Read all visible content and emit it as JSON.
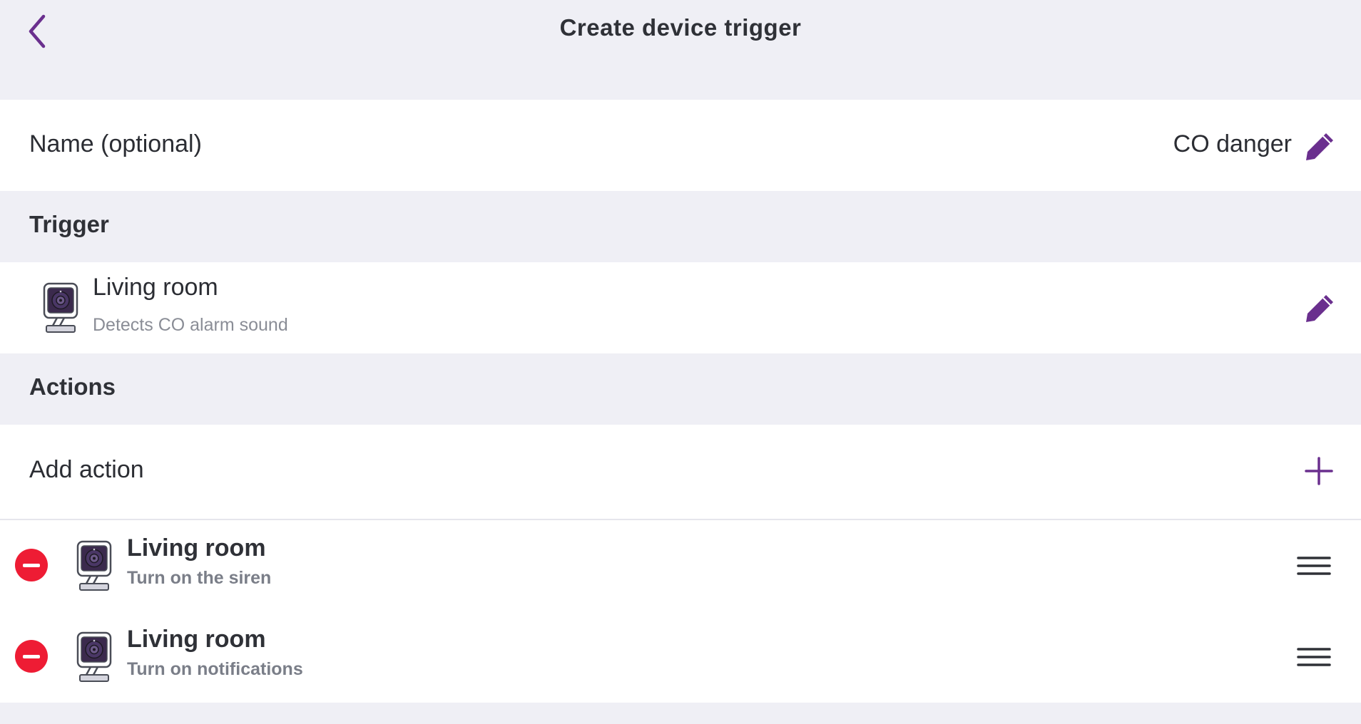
{
  "header": {
    "title": "Create device trigger",
    "back_icon": "chevron-left-icon"
  },
  "name_row": {
    "label": "Name (optional)",
    "value": "CO danger",
    "edit_icon": "pencil-icon"
  },
  "trigger_section": {
    "title": "Trigger",
    "item": {
      "device": "Living room",
      "description": "Detects CO alarm sound",
      "icon": "camera-icon",
      "edit_icon": "pencil-icon"
    }
  },
  "actions_section": {
    "title": "Actions",
    "add_label": "Add action",
    "add_icon": "plus-icon",
    "items": [
      {
        "device": "Living room",
        "description": "Turn on the siren",
        "icon": "camera-icon",
        "remove_icon": "minus-circle-icon",
        "drag_icon": "drag-handle-icon"
      },
      {
        "device": "Living room",
        "description": "Turn on notifications",
        "icon": "camera-icon",
        "remove_icon": "minus-circle-icon",
        "drag_icon": "drag-handle-icon"
      }
    ]
  },
  "colors": {
    "accent": "#6a2f8e",
    "background": "#efeff5",
    "remove": "#ee1c34",
    "text": "#2b2d33",
    "subtext": "#8a8d96"
  }
}
